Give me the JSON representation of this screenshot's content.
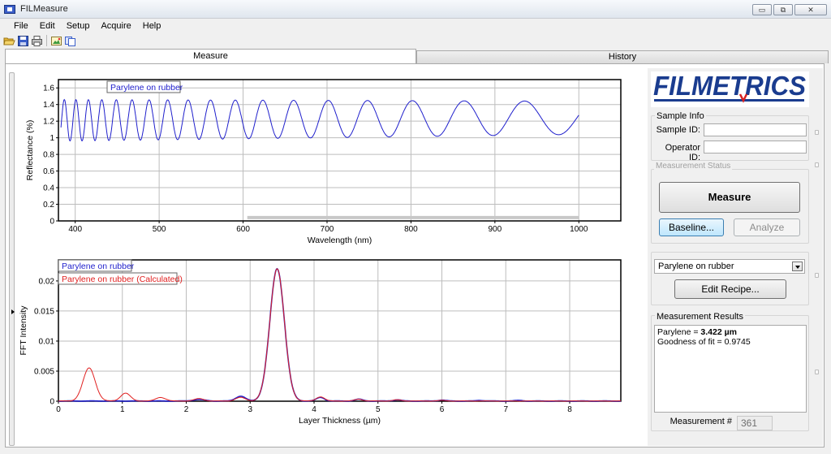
{
  "window": {
    "title": "FILMeasure",
    "buttons": [
      "▭",
      "⧉",
      "✕"
    ]
  },
  "menu": [
    "File",
    "Edit",
    "Setup",
    "Acquire",
    "Help"
  ],
  "toolbar": {
    "icons": [
      "open-folder-icon",
      "save-icon",
      "print-icon",
      "image-icon",
      "copy-icon"
    ]
  },
  "tabs": [
    {
      "label": "Measure",
      "active": true
    },
    {
      "label": "History",
      "active": false
    }
  ],
  "logo": {
    "text": "FILMETRICS",
    "color": "#1a3c8f"
  },
  "sample_info": {
    "title": "Sample Info",
    "sample_id_label": "Sample ID:",
    "sample_id_value": "",
    "operator_id_label": "Operator ID:",
    "operator_id_value": ""
  },
  "measurement_status": {
    "title": "Measurement Status",
    "measure_label": "Measure",
    "baseline_label": "Baseline...",
    "analyze_label": "Analyze"
  },
  "recipe": {
    "selected": "Parylene on rubber",
    "edit_label": "Edit Recipe..."
  },
  "results": {
    "title": "Measurement Results",
    "line1_prefix": "Parylene = ",
    "line1_value": "3.422 µm",
    "line2": "Goodness of fit = 0.9745",
    "measurement_label": "Measurement #",
    "measurement_number": "361"
  },
  "chart_data": [
    {
      "type": "line",
      "xlabel": "Wavelength (nm)",
      "ylabel": "Reflectance (%)",
      "xlim": [
        380,
        1050
      ],
      "ylim": [
        0,
        1.7
      ],
      "xticks": [
        400,
        500,
        600,
        700,
        800,
        900,
        1000
      ],
      "yticks": [
        0,
        0.2,
        0.4,
        0.6,
        0.8,
        1,
        1.2,
        1.4,
        1.6
      ],
      "ytick_labels": [
        "0",
        "0.2",
        "0.4",
        "0.6",
        "0.8",
        "1",
        "1.2",
        "1.4",
        "1.6"
      ],
      "grid": true,
      "legend": [
        "Parylene on rubber"
      ],
      "series": [
        {
          "name": "Parylene on rubber",
          "color": "#1f1fcc",
          "model": {
            "thickness_um": 3.422,
            "index": 1.64,
            "mean": 1.23,
            "amplitude_start": 0.25,
            "amplitude_end": 0.2,
            "x_start": 383,
            "x_end": 1000
          }
        }
      ],
      "range_bar": {
        "from": 605,
        "to": 1000,
        "color": "#c8c8c8"
      }
    },
    {
      "type": "line",
      "xlabel": "Layer Thickness (µm)",
      "ylabel": "FFT Intensity",
      "xlim": [
        0,
        8.8
      ],
      "ylim": [
        0,
        0.0235
      ],
      "xticks": [
        0,
        1,
        2,
        3,
        4,
        5,
        6,
        7,
        8
      ],
      "yticks": [
        0,
        0.005,
        0.01,
        0.015,
        0.02
      ],
      "ytick_labels": [
        "0",
        "0.005",
        "0.01",
        "0.015",
        "0.02"
      ],
      "grid": true,
      "legend": [
        "Parylene on rubber",
        "Parylene on rubber (Calculated)"
      ],
      "series": [
        {
          "name": "Parylene on rubber",
          "color": "#1f1fcc",
          "peaks": [
            [
              3.422,
              0.022,
              0.18
            ],
            [
              2.85,
              0.0008,
              0.12
            ],
            [
              2.2,
              0.00025,
              0.15
            ],
            [
              4.1,
              0.0006,
              0.1
            ],
            [
              4.7,
              0.0003,
              0.1
            ],
            [
              5.3,
              0.0002,
              0.1
            ],
            [
              6.0,
              0.00015,
              0.1
            ],
            [
              6.6,
              0.0001,
              0.1
            ],
            [
              7.2,
              0.0001,
              0.1
            ]
          ]
        },
        {
          "name": "Parylene on rubber (Calculated)",
          "color": "#e02020",
          "peaks": [
            [
              3.422,
              0.022,
              0.18
            ],
            [
              0.48,
              0.0055,
              0.15
            ],
            [
              1.05,
              0.0013,
              0.12
            ],
            [
              1.6,
              0.0006,
              0.12
            ],
            [
              2.2,
              0.0004,
              0.12
            ],
            [
              2.85,
              0.0006,
              0.12
            ],
            [
              4.1,
              0.0007,
              0.1
            ],
            [
              4.7,
              0.0003,
              0.1
            ],
            [
              5.3,
              0.0002,
              0.1
            ],
            [
              6.0,
              0.0001,
              0.1
            ]
          ]
        }
      ]
    }
  ]
}
